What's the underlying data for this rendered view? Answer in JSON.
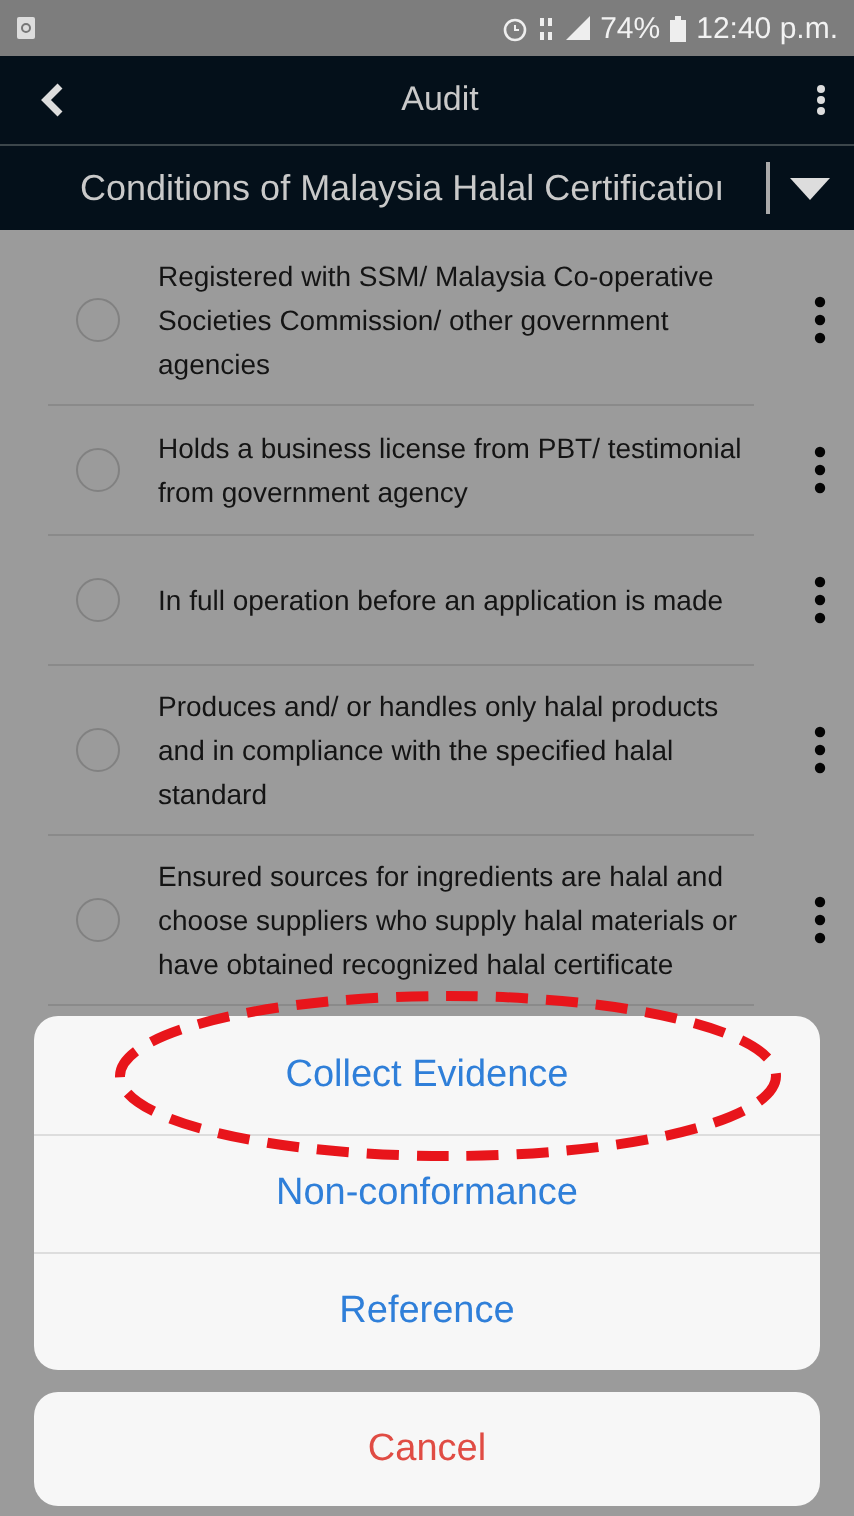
{
  "status_bar": {
    "battery": "74%",
    "time": "12:40 p.m."
  },
  "header": {
    "title": "Audit",
    "dropdown": "Conditions of Malaysia Halal Certificatioı"
  },
  "items": [
    {
      "text": "Registered with SSM/ Malaysia Co-operative Societies Commission/ other government agencies",
      "checked": false
    },
    {
      "text": "Holds a business license from PBT/ testimonial from government agency",
      "checked": false
    },
    {
      "text": "In full operation before an application is made",
      "checked": false
    },
    {
      "text": "Produces and/ or handles only halal products and in compliance with the specified halal standard",
      "checked": false
    },
    {
      "text": "Ensured sources for ingredients are halal and choose suppliers who supply halal materials or have obtained recognized halal certificate",
      "checked": false
    }
  ],
  "action_sheet": {
    "actions": [
      {
        "label": "Collect Evidence",
        "circled": true
      },
      {
        "label": "Non-conformance",
        "circled": false
      },
      {
        "label": "Reference",
        "circled": false
      }
    ],
    "cancel": "Cancel"
  }
}
